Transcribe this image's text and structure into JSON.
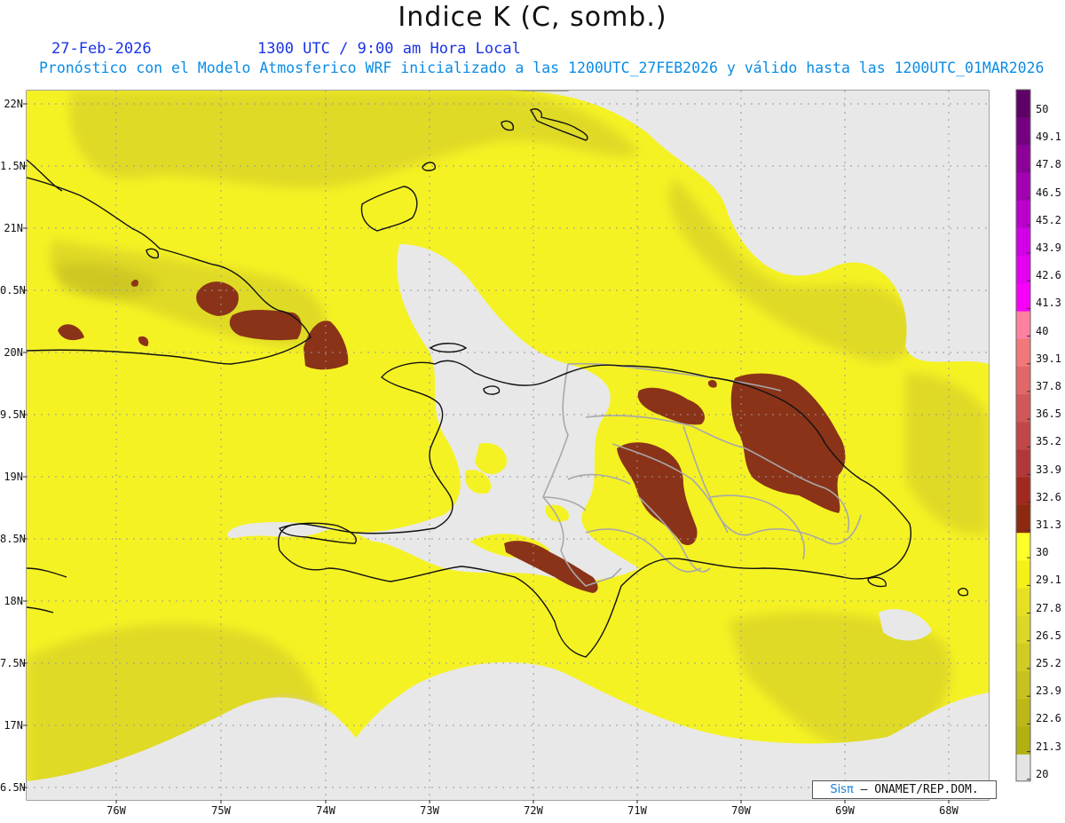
{
  "header": {
    "title": "Indice K (C, somb.)",
    "date": "27-Feb-2026",
    "time": "1300 UTC / 9:00 am Hora Local",
    "subtitle": "Pronóstico con el Modelo Atmosferico WRF inicializado a las 1200UTC_27FEB2026 y válido hasta las  1200UTC_01MAR2026"
  },
  "axes": {
    "lat_labels": [
      "22N",
      "1.5N",
      "21N",
      "0.5N",
      "20N",
      "9.5N",
      "19N",
      "8.5N",
      "18N",
      "7.5N",
      "17N",
      "6.5N"
    ],
    "lon_labels": [
      "76W",
      "75W",
      "74W",
      "73W",
      "72W",
      "71W",
      "70W",
      "69W",
      "68W"
    ]
  },
  "colorbar": {
    "labels": [
      "50",
      "49.1",
      "47.8",
      "46.5",
      "45.2",
      "43.9",
      "42.6",
      "41.3",
      "40",
      "39.1",
      "37.8",
      "36.5",
      "35.2",
      "33.9",
      "32.6",
      "31.3",
      "30",
      "29.1",
      "27.8",
      "26.5",
      "25.2",
      "23.9",
      "22.6",
      "21.3",
      "20"
    ],
    "colors": [
      "#5e0065",
      "#740080",
      "#8c0099",
      "#a300b2",
      "#bb00cc",
      "#d200e6",
      "#e600f0",
      "#f600f9",
      "#ff80a0",
      "#f07878",
      "#e06868",
      "#d05858",
      "#c04848",
      "#b03838",
      "#a02a20",
      "#8c2a10",
      "#ffff2a",
      "#f4f018",
      "#e6e024",
      "#dcd628",
      "#d0cc24",
      "#c6c220",
      "#bcb818",
      "#b2b010"
    ],
    "no_data_color": "#e4e4e4"
  },
  "map": {
    "background_color": "#e8e8e8",
    "field_color": "#f5f224",
    "shade_color": "#dcd628",
    "dark_shade_color": "#c6c020",
    "storm_color": "#8a3318",
    "border_color": "#aaaaaa",
    "coast_color": "#111111"
  },
  "credit": {
    "brand": "Sisπ",
    "text": " – ONAMET/REP.DOM."
  }
}
